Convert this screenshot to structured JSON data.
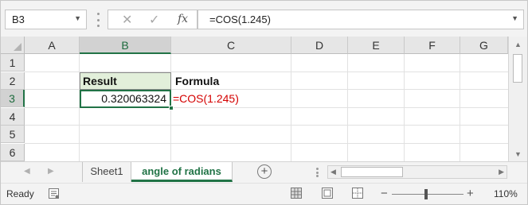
{
  "formula_bar": {
    "name_box": "B3",
    "cancel_icon": "✕",
    "enter_icon": "✓",
    "fx_label": "fx",
    "formula": "=COS(1.245)"
  },
  "columns": [
    "A",
    "B",
    "C",
    "D",
    "E",
    "F",
    "G"
  ],
  "rows": [
    "1",
    "2",
    "3",
    "4",
    "5",
    "6"
  ],
  "selected": {
    "column": "B",
    "row": "3"
  },
  "cells": {
    "B2": "Result",
    "C2": "Formula",
    "B3": "0.320063324",
    "C3": "=COS(1.245)"
  },
  "colors": {
    "accent": "#217346",
    "header_fill": "#e2efda",
    "formula_text": "#d40000"
  },
  "sheet_tabs": [
    {
      "label": "Sheet1",
      "active": false
    },
    {
      "label": "angle of radians",
      "active": true
    }
  ],
  "status_bar": {
    "status": "Ready",
    "zoom_minus": "−",
    "zoom_plus": "+",
    "zoom": "110%"
  },
  "icons": {
    "add_sheet": "plus-circle-icon",
    "views": [
      "normal-view-icon",
      "page-layout-icon",
      "page-break-icon"
    ]
  }
}
